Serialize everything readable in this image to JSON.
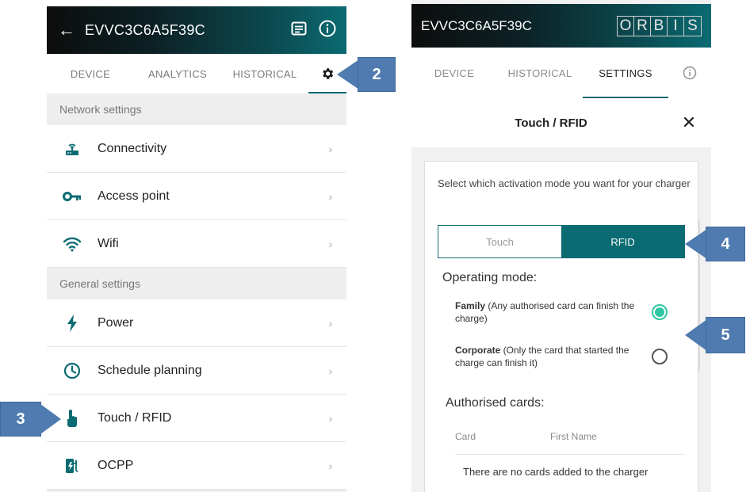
{
  "left_screen": {
    "title": "EVVC3C6A5F39C",
    "tabs": [
      {
        "label": "DEVICE"
      },
      {
        "label": "ANALYTICS"
      },
      {
        "label": "HISTORICAL"
      }
    ],
    "sections": [
      {
        "header": "Network settings",
        "items": [
          {
            "label": "Connectivity",
            "icon": "router-icon"
          },
          {
            "label": "Access point",
            "icon": "key-icon"
          },
          {
            "label": "Wifi",
            "icon": "wifi-icon"
          }
        ]
      },
      {
        "header": "General settings",
        "items": [
          {
            "label": "Power",
            "icon": "lightning-icon"
          },
          {
            "label": "Schedule planning",
            "icon": "clock-icon"
          },
          {
            "label": "Touch / RFID",
            "icon": "touch-icon"
          },
          {
            "label": "OCPP",
            "icon": "ocpp-icon"
          }
        ]
      }
    ],
    "chevron": "›"
  },
  "callouts": {
    "c2": "2",
    "c3": "3",
    "c4": "4",
    "c5": "5"
  },
  "right_screen": {
    "title": "EVVC3C6A5F39C",
    "brand_letters": [
      "O",
      "R",
      "B",
      "I",
      "S"
    ],
    "tabs": [
      {
        "label": "DEVICE"
      },
      {
        "label": "HISTORICAL"
      },
      {
        "label": "SETTINGS"
      }
    ],
    "modal": {
      "title": "Touch / RFID",
      "close": "✕",
      "description": "Select which activation mode you want for your charger",
      "segment": {
        "touch": "Touch",
        "rfid": "RFID",
        "selected": "RFID"
      },
      "operating_mode_label": "Operating mode:",
      "options": [
        {
          "name": "Family",
          "desc": " (Any authorised card can finish the charge)",
          "selected": true
        },
        {
          "name": "Corporate",
          "desc": " (Only the card that started the charge can finish it)",
          "selected": false
        }
      ],
      "authorised_label": "Authorised cards:",
      "columns": {
        "card": "Card",
        "first_name": "First Name"
      },
      "empty_message": "There are no cards added to the charger"
    }
  },
  "colors": {
    "accent": "#0b6b72",
    "radio_on": "#2fc7a3",
    "callout": "#4f7bb0"
  }
}
